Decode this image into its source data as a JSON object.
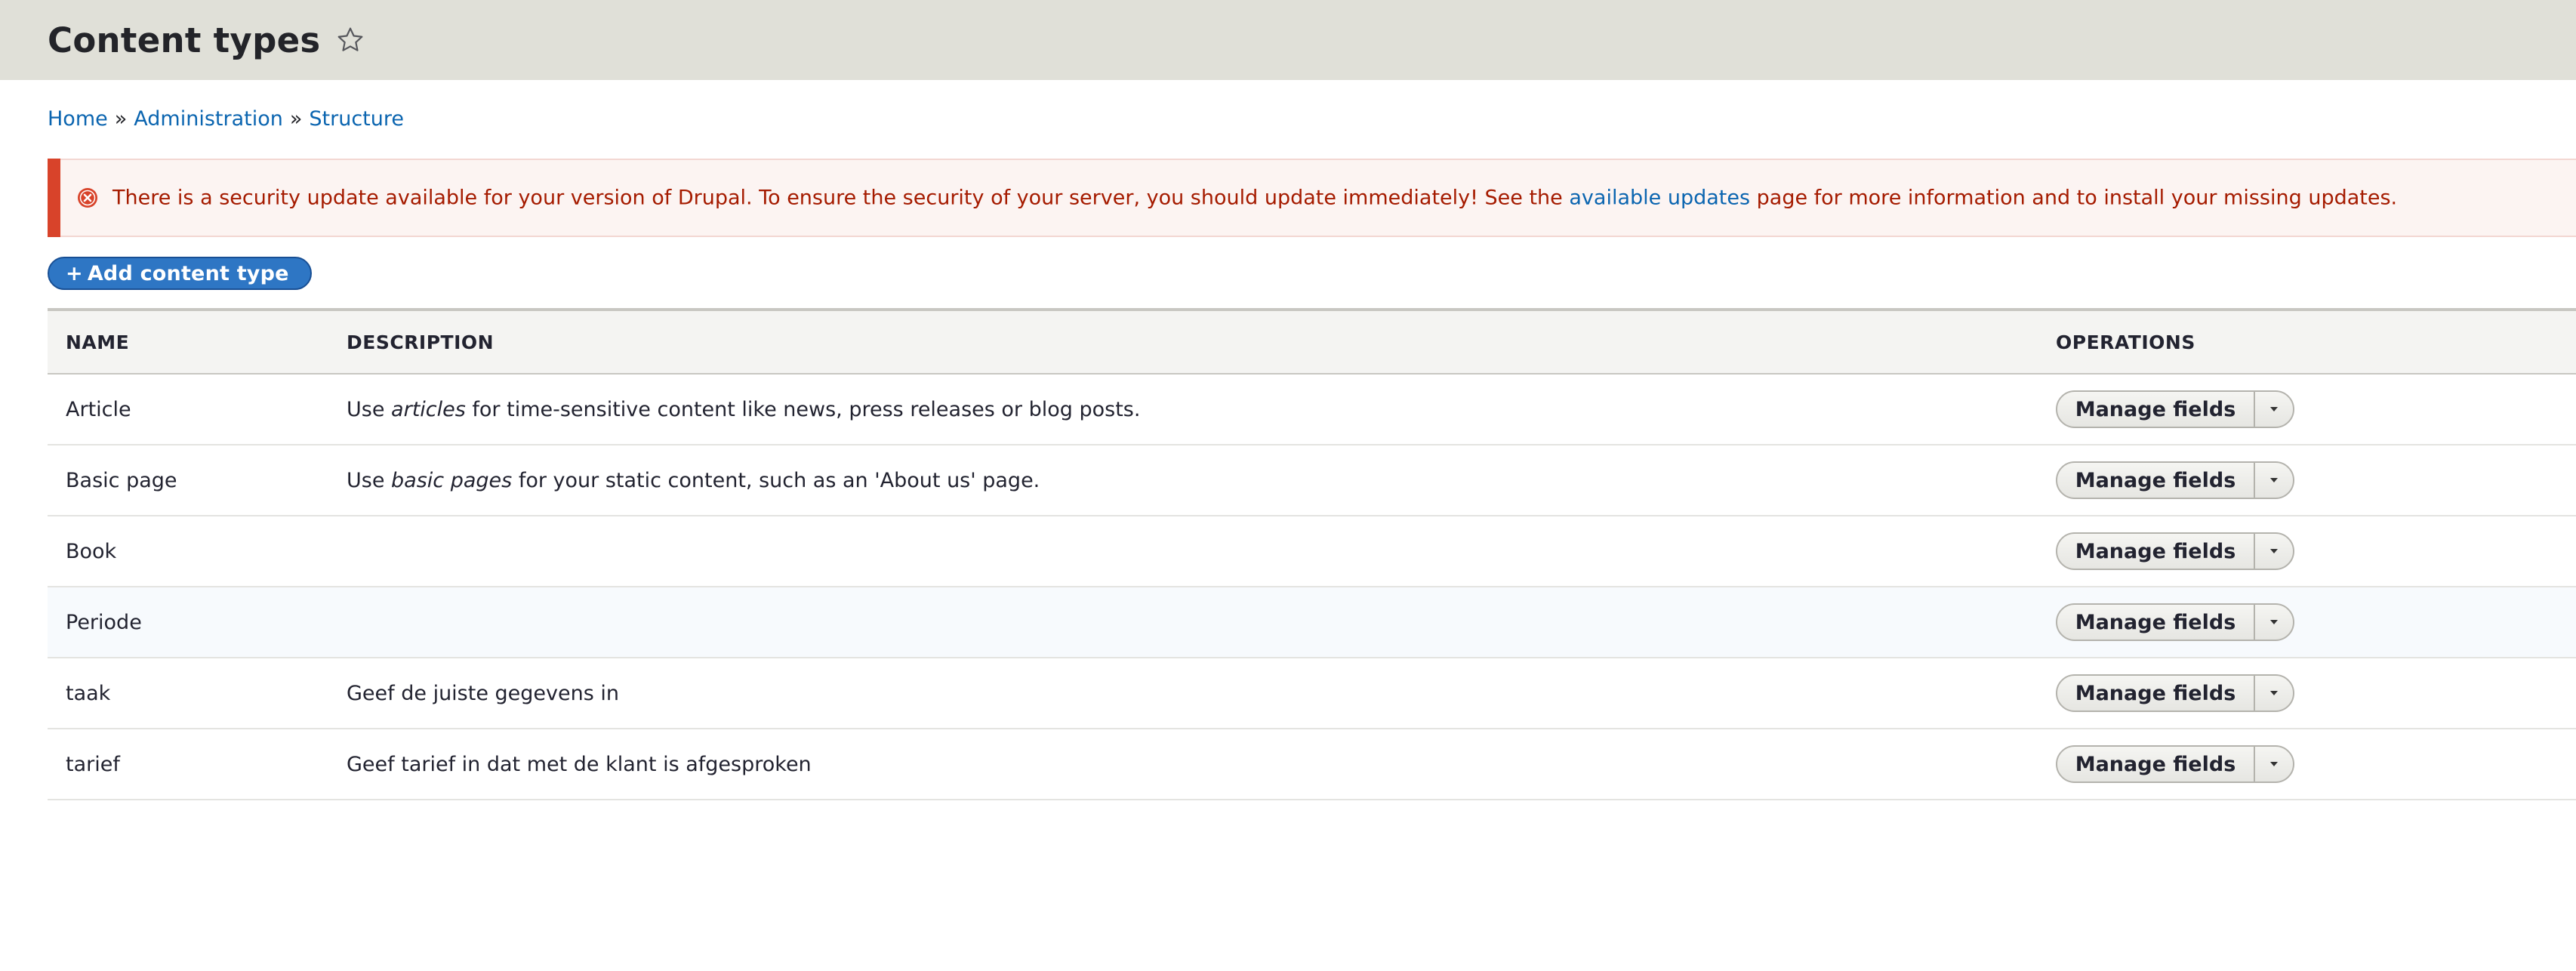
{
  "header": {
    "title": "Content types",
    "star_icon": "star-outline-icon"
  },
  "breadcrumb": {
    "items": [
      "Home",
      "Administration",
      "Structure"
    ],
    "separator": "»"
  },
  "alert": {
    "text_before": "There is a security update available for your version of Drupal. To ensure the security of your server, you should update immediately! See the",
    "link": "available updates",
    "text_after": "page for more information and to install your missing updates.",
    "icon": "error-circle-icon",
    "color": "#d8432a"
  },
  "add_button": {
    "plus": "+",
    "label": "Add content type",
    "color": "#2e76c4"
  },
  "table": {
    "headers": {
      "name": "NAME",
      "description": "DESCRIPTION",
      "operations": "OPERATIONS"
    },
    "rows": [
      {
        "name": "Article",
        "desc_pre": "Use",
        "desc_em": "articles",
        "desc_post": "for time-sensitive content like news, press releases or blog posts.",
        "op": "Manage fields"
      },
      {
        "name": "Basic page",
        "desc_pre": "Use",
        "desc_em": "basic pages",
        "desc_post": "for your static content, such as an 'About us' page.",
        "op": "Manage fields"
      },
      {
        "name": "Book",
        "desc_pre": "",
        "desc_em": "",
        "desc_post": "",
        "op": "Manage fields"
      },
      {
        "name": "Periode",
        "desc_pre": "",
        "desc_em": "",
        "desc_post": "",
        "op": "Manage fields"
      },
      {
        "name": "taak",
        "desc_pre": "Geef de juiste gegevens in",
        "desc_em": "",
        "desc_post": "",
        "op": "Manage fields"
      },
      {
        "name": "tarief",
        "desc_pre": "Geef tarief in dat met de klant is afgesproken",
        "desc_em": "",
        "desc_post": "",
        "op": "Manage fields"
      }
    ]
  }
}
